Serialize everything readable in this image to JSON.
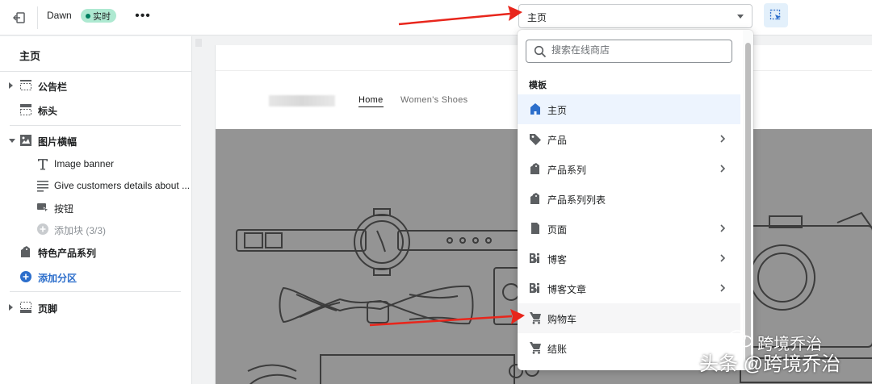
{
  "topbar": {
    "theme_name": "Dawn",
    "live_badge": "实时",
    "more_label": "•••",
    "template_select_value": "主页"
  },
  "sidebar": {
    "title": "主页",
    "items": [
      {
        "label": "公告栏",
        "icon": "announcement-bar-icon"
      },
      {
        "label": "标头",
        "icon": "header-icon"
      },
      {
        "label": "图片横幅",
        "icon": "image-icon"
      },
      {
        "label": "Image banner",
        "icon": "text-icon"
      },
      {
        "label": "Give customers details about ...",
        "icon": "paragraph-icon"
      },
      {
        "label": "按钮",
        "icon": "button-icon"
      },
      {
        "label": "添加块 (3/3)",
        "icon": "plus-circle-icon"
      },
      {
        "label": "特色产品系列",
        "icon": "collection-icon"
      },
      {
        "label": "添加分区",
        "icon": "plus-circle-icon"
      },
      {
        "label": "页脚",
        "icon": "footer-icon"
      }
    ]
  },
  "preview": {
    "nav_home": "Home",
    "nav_shoes": "Women's Shoes"
  },
  "dropdown": {
    "search_placeholder": "搜索在线商店",
    "section_label": "模板",
    "items": [
      {
        "label": "主页",
        "icon": "home-icon",
        "has_submenu": false
      },
      {
        "label": "产品",
        "icon": "tag-icon",
        "has_submenu": true
      },
      {
        "label": "产品系列",
        "icon": "collection-icon",
        "has_submenu": true
      },
      {
        "label": "产品系列列表",
        "icon": "collection-icon",
        "has_submenu": false
      },
      {
        "label": "页面",
        "icon": "page-icon",
        "has_submenu": true
      },
      {
        "label": "博客",
        "icon": "blog-icon",
        "has_submenu": true
      },
      {
        "label": "博客文章",
        "icon": "blog-icon",
        "has_submenu": true
      },
      {
        "label": "购物车",
        "icon": "cart-icon",
        "has_submenu": false
      },
      {
        "label": "结账",
        "icon": "cart-icon",
        "has_submenu": false
      }
    ]
  },
  "watermark": {
    "top": "跨境乔治",
    "bottom": "头条 @跨境乔治"
  },
  "colors": {
    "accent": "#2c6ecb",
    "live_badge_bg": "#aee9d1",
    "arrow_red": "#e8261c"
  }
}
